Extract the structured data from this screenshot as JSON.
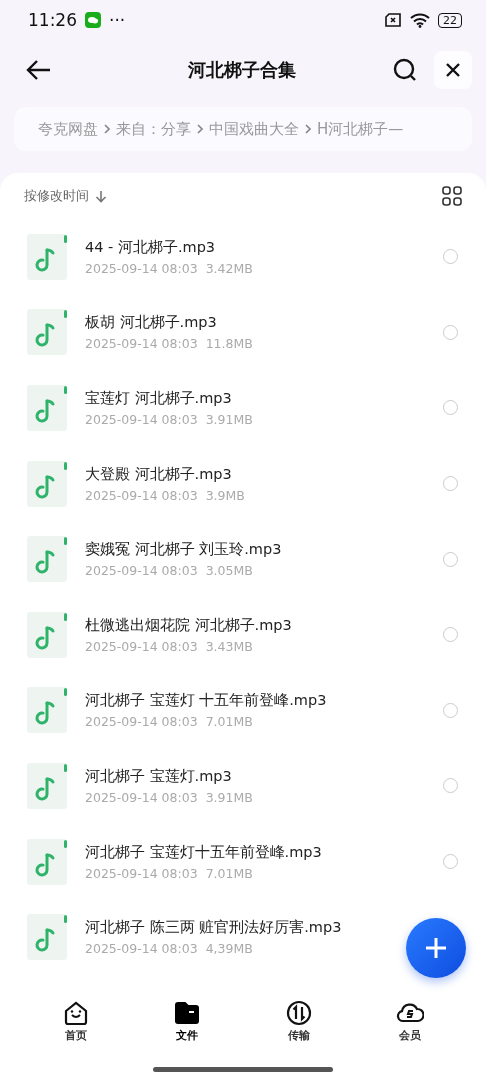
{
  "status_bar": {
    "time": "11:26",
    "dots": "···",
    "battery": "22"
  },
  "header": {
    "title": "河北梆子合集"
  },
  "breadcrumb": [
    "夸克网盘",
    "来自：分享",
    "中国戏曲大全",
    "H河北梆子—"
  ],
  "sort": {
    "label": "按修改时间"
  },
  "files": [
    {
      "name": "44 - 河北梆子.mp3",
      "date": "2025-09-14 08:03",
      "size": "3.42MB",
      "selected": false
    },
    {
      "name": "板胡 河北梆子.mp3",
      "date": "2025-09-14 08:03",
      "size": "11.8MB",
      "selected": false
    },
    {
      "name": "宝莲灯 河北梆子.mp3",
      "date": "2025-09-14 08:03",
      "size": "3.91MB",
      "selected": false
    },
    {
      "name": "大登殿 河北梆子.mp3",
      "date": "2025-09-14 08:03",
      "size": "3.9MB",
      "selected": false
    },
    {
      "name": "窦娥冤 河北梆子 刘玉玲.mp3",
      "date": "2025-09-14 08:03",
      "size": "3.05MB",
      "selected": false
    },
    {
      "name": "杜微逃出烟花院 河北梆子.mp3",
      "date": "2025-09-14 08:03",
      "size": "3.43MB",
      "selected": false
    },
    {
      "name": "河北梆子 宝莲灯 十五年前登峰.mp3",
      "date": "2025-09-14 08:03",
      "size": "7.01MB",
      "selected": false
    },
    {
      "name": "河北梆子 宝莲灯.mp3",
      "date": "2025-09-14 08:03",
      "size": "3.91MB",
      "selected": false
    },
    {
      "name": "河北梆子 宝莲灯十五年前登峰.mp3",
      "date": "2025-09-14 08:03",
      "size": "7.01MB",
      "selected": false
    },
    {
      "name": "河北梆子 陈三两 赃官刑法好厉害.mp3",
      "date": "2025-09-14 08:03",
      "size": "4,39MB"
    }
  ],
  "nav": [
    {
      "kind": "home",
      "label": "首页",
      "selected": false
    },
    {
      "kind": "files",
      "label": "文件",
      "selected": true
    },
    {
      "kind": "transfer",
      "label": "传输",
      "selected": false
    },
    {
      "kind": "vip",
      "label": "会员",
      "selected": false
    }
  ]
}
